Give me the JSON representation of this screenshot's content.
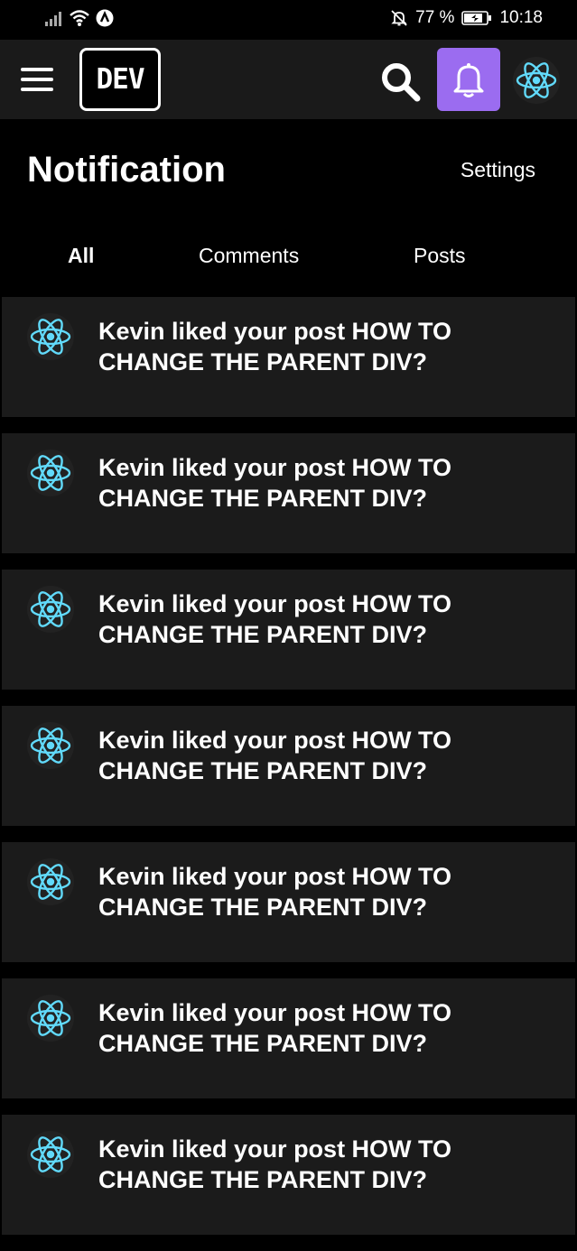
{
  "status_bar": {
    "battery_percent": "77 %",
    "time": "10:18"
  },
  "app_bar": {
    "logo_text": "DEV",
    "icons": [
      "menu-icon",
      "search-icon",
      "bell-icon",
      "react-avatar-icon"
    ],
    "accent_color": "#9b6cf0"
  },
  "page": {
    "title": "Notification",
    "settings_label": "Settings"
  },
  "tabs": [
    {
      "label": "All",
      "active": true
    },
    {
      "label": "Comments",
      "active": false
    },
    {
      "label": "Posts",
      "active": false
    }
  ],
  "notifications": [
    {
      "text": "Kevin liked your post HOW TO CHANGE THE PARENT DIV?"
    },
    {
      "text": "Kevin liked your post HOW TO CHANGE THE PARENT DIV?"
    },
    {
      "text": "Kevin liked your post HOW TO CHANGE THE PARENT DIV?"
    },
    {
      "text": "Kevin liked your post HOW TO CHANGE THE PARENT DIV?"
    },
    {
      "text": "Kevin liked your post HOW TO CHANGE THE PARENT DIV?"
    },
    {
      "text": "Kevin liked your post HOW TO CHANGE THE PARENT DIV?"
    },
    {
      "text": "Kevin liked your post HOW TO CHANGE THE PARENT DIV?"
    }
  ]
}
